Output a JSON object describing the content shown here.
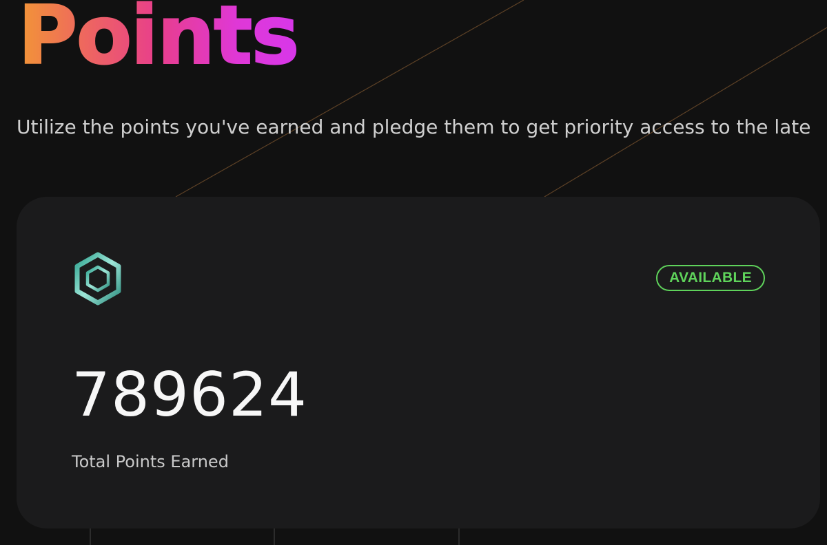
{
  "page": {
    "title": "Points",
    "description": "Utilize the points you've earned and pledge them to get priority access to the late"
  },
  "points_card": {
    "icon": "hexagon-token-icon",
    "status": "AVAILABLE",
    "total_points": "789624",
    "total_label": "Total Points Earned"
  },
  "colors": {
    "background": "#111111",
    "card": "#1b1b1c",
    "status_green": "#5fd35b",
    "title_gradient": [
      "#f29636",
      "#e83e8c",
      "#d737ea"
    ],
    "accent_teal": "#7fd6c8"
  }
}
